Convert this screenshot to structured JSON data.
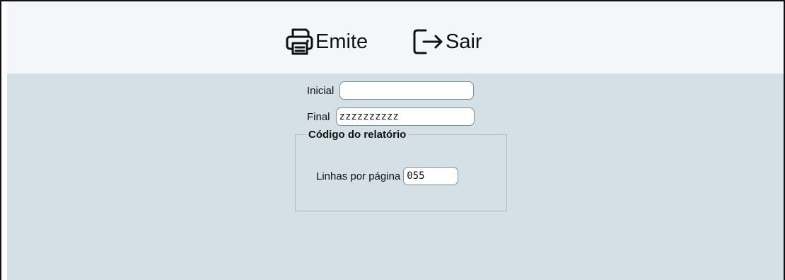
{
  "toolbar": {
    "emite_label": "Emite",
    "emite_icon": "printer-icon",
    "sair_label": "Sair",
    "sair_icon": "exit-icon"
  },
  "form": {
    "group_title": "Código do relatório",
    "inicial_label": "Inicial",
    "inicial_value": "",
    "final_label": "Final",
    "final_value": "zzzzzzzzzz",
    "linhas_label": "Linhas por página",
    "linhas_value": "055"
  },
  "colors": {
    "toolbar_bg": "#f4f6f9",
    "body_bg": "#d5dfe6",
    "input_border": "#7a8fa3"
  }
}
